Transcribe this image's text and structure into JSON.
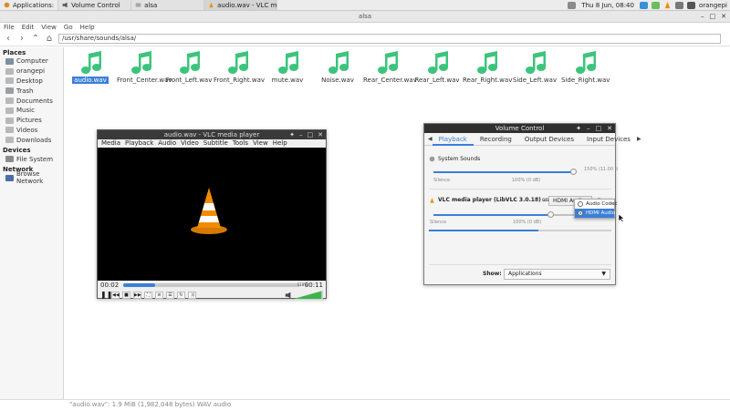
{
  "taskbar": {
    "applications_label": "Applications:",
    "tasks": [
      {
        "label": "Volume Control"
      },
      {
        "label": "alsa"
      },
      {
        "label": "audio.wav - VLC media ..."
      }
    ],
    "clock": "Thu  8 Jun, 08:40",
    "user": "orangepi"
  },
  "file_manager": {
    "window_title": "alsa",
    "menus": [
      "File",
      "Edit",
      "View",
      "Go",
      "Help"
    ],
    "location": "/usr/share/sounds/alsa/",
    "sidebar": {
      "places_heading": "Places",
      "places": [
        {
          "label": "Computer",
          "icon": "computer-icon"
        },
        {
          "label": "orangepi",
          "icon": "home-folder-icon"
        },
        {
          "label": "Desktop",
          "icon": "desktop-folder-icon"
        },
        {
          "label": "Trash",
          "icon": "trash-icon"
        },
        {
          "label": "Documents",
          "icon": "documents-folder-icon"
        },
        {
          "label": "Music",
          "icon": "music-folder-icon"
        },
        {
          "label": "Pictures",
          "icon": "pictures-folder-icon"
        },
        {
          "label": "Videos",
          "icon": "videos-folder-icon"
        },
        {
          "label": "Downloads",
          "icon": "downloads-folder-icon"
        }
      ],
      "devices_heading": "Devices",
      "devices": [
        {
          "label": "File System",
          "icon": "drive-icon"
        }
      ],
      "network_heading": "Network",
      "network": [
        {
          "label": "Browse Network",
          "icon": "network-icon"
        }
      ]
    },
    "files": [
      {
        "name": "audio.wav",
        "selected": true
      },
      {
        "name": "Front_Center.wav"
      },
      {
        "name": "Front_Left.wav"
      },
      {
        "name": "Front_Right.wav"
      },
      {
        "name": "mute.wav"
      },
      {
        "name": "Noise.wav"
      },
      {
        "name": "Rear_Center.wav"
      },
      {
        "name": "Rear_Left.wav"
      },
      {
        "name": "Rear_Right.wav"
      },
      {
        "name": "Side_Left.wav"
      },
      {
        "name": "Side_Right.wav"
      }
    ],
    "status": "\"audio.wav\": 1.9 MiB (1,982,048 bytes) WAV audio"
  },
  "vlc": {
    "window_title": "audio.wav - VLC media player",
    "menus": [
      "Media",
      "Playback",
      "Audio",
      "Video",
      "Subtitle",
      "Tools",
      "View",
      "Help"
    ],
    "elapsed": "00:02",
    "total": "00:11",
    "progress": 0.18,
    "volume_label": "118%",
    "volume_level": 1.18
  },
  "volume_control": {
    "window_title": "Volume Control",
    "tabs": [
      "Playback",
      "Recording",
      "Output Devices",
      "Input Devices"
    ],
    "active_tab": "Playback",
    "system_sounds": {
      "label": "System Sounds",
      "percent_label": "150% (11.00 d",
      "silence_label": "Silence",
      "mark_label": "100% (0 dB)",
      "level": 1.5
    },
    "stream": {
      "label": "VLC media player (LibVLC 3.0.18) ...",
      "on_label": "on",
      "device_button": "HDMI Audio",
      "silence_label": "Silence",
      "mark_label": "100% (0 dB)",
      "level": 1.0
    },
    "device_popup": {
      "options": [
        {
          "label": "Audio Codec",
          "selected": false
        },
        {
          "label": "HDMI Audio",
          "selected": true
        }
      ]
    },
    "show_label": "Show:",
    "show_value": "Applications"
  },
  "colors": {
    "accent": "#3b7fd9",
    "wav_icon": "#3cc47c",
    "vlc_orange": "#f28b00"
  }
}
